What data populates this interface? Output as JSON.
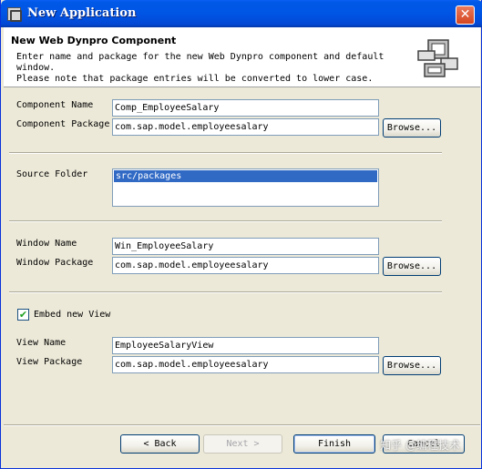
{
  "window": {
    "title": "New Application"
  },
  "header": {
    "title": "New Web Dynpro Component",
    "description": "Enter name and package for the new Web Dynpro component and default\nwindow.\nPlease note that package entries will be converted to lower case."
  },
  "component": {
    "name_label": "Component Name",
    "name_value": "Comp_EmployeeSalary",
    "package_label": "Component Package",
    "package_value": "com.sap.model.employeesalary",
    "browse_label": "Browse..."
  },
  "source": {
    "label": "Source Folder",
    "items": [
      "src/packages"
    ]
  },
  "window_section": {
    "name_label": "Window Name",
    "name_value": "Win_EmployeeSalary",
    "package_label": "Window Package",
    "package_value": "com.sap.model.employeesalary",
    "browse_label": "Browse..."
  },
  "embed": {
    "label": "Embed new View",
    "checked": true
  },
  "view": {
    "name_label": "View Name",
    "name_value": "EmployeeSalaryView",
    "package_label": "View Package",
    "package_value": "com.sap.model.employeesalary",
    "browse_label": "Browse..."
  },
  "footer": {
    "back_label": "< Back",
    "next_label": "Next >",
    "finish_label": "Finish",
    "cancel_label": "Cancel"
  },
  "watermark": "知乎 @编程技术",
  "colors": {
    "titlebar": "#0055e5",
    "dialog_bg": "#ece9d8",
    "selection": "#316ac5",
    "field_border": "#7f9db9"
  }
}
